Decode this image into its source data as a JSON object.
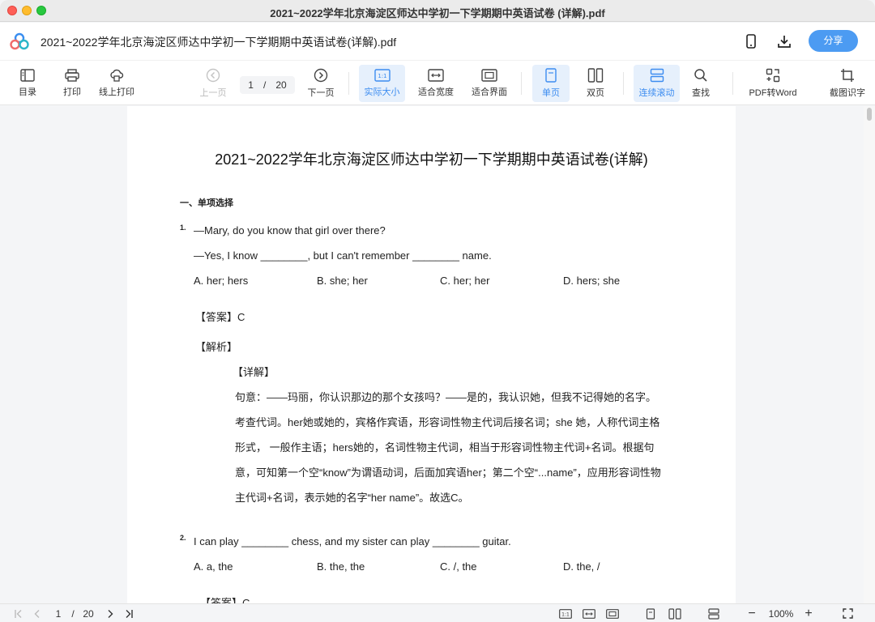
{
  "window": {
    "title": "2021~2022学年北京海淀区师达中学初一下学期期中英语试卷 (详解).pdf"
  },
  "header": {
    "doc_name": "2021~2022学年北京海淀区师达中学初一下学期期中英语试卷(详解).pdf",
    "share_label": "分享",
    "icons": [
      "app-logo-icon",
      "phone-icon",
      "download-icon"
    ]
  },
  "toolbar": {
    "toc": "目录",
    "print": "打印",
    "online_print": "线上打印",
    "prev": "上一页",
    "current_page": "1",
    "page_sep": "/",
    "total_pages": "20",
    "next": "下一页",
    "actual_size": "实际大小",
    "actual_size_glyph": "1:1",
    "fit_width": "适合宽度",
    "fit_page": "适合界面",
    "single": "单页",
    "double": "双页",
    "continuous": "连续滚动",
    "find": "查找",
    "pdf_to_word": "PDF转Word",
    "ocr": "截图识字",
    "accent": "#3c8cf0"
  },
  "doc": {
    "title": "2021~2022学年北京海淀区师达中学初一下学期期中英语试卷(详解)",
    "section": "一、单项选择",
    "q1": {
      "num": "1.",
      "line1": "—Mary, do you know that girl over there?",
      "line2": "—Yes, I know ________, but I can't remember ________ name.",
      "options": [
        "A. her; hers",
        "B. she; her",
        "C. her; her",
        "D. hers; she"
      ],
      "answer": "【答案】C",
      "analysis": "【解析】",
      "detail": "【详解】",
      "exp": [
        "句意：——玛丽，你认识那边的那个女孩吗？——是的，我认识她，但我不记得她的名字。",
        "考查代词。her她或她的，宾格作宾语，形容词性物主代词后接名词；she 她，人称代词主格",
        "形式， 一般作主语；hers她的，名词性物主代词，相当于形容词性物主代词+名词。根据句",
        "意，可知第一个空“know”为谓语动词，后面加宾语her；第二个空“...name”，应用形容词性物",
        "主代词+名词，表示她的名字“her name”。故选C。"
      ]
    },
    "q2": {
      "num": "2.",
      "line1": "I can play ________ chess, and my sister can play ________ guitar.",
      "options": [
        "A. a, the",
        "B. the, the",
        "C. /, the",
        "D. the, /"
      ],
      "answer": "【答案】C"
    }
  },
  "statusbar": {
    "current_page": "1",
    "sep": "/",
    "total_pages": "20",
    "zoom": "100%",
    "zoom_out": "−",
    "zoom_in": "+",
    "glyph_1to1": "1:1"
  }
}
